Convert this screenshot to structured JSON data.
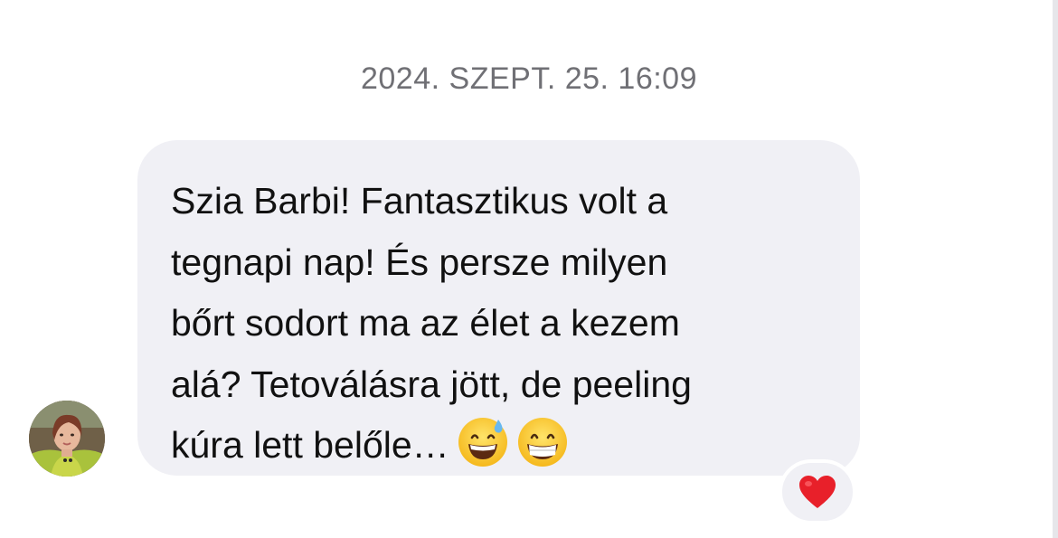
{
  "conversation": {
    "timestamp": "2024. SZEPT. 25. 16:09",
    "message": {
      "lines": [
        "Szia Barbi! Fantasztikus volt a",
        "tegnapi nap! És persze milyen",
        "bőrt sodort ma az élet a kezem",
        "alá? Tetoválásra jött, de peeling",
        "kúra lett belőle…"
      ],
      "trailing_emojis": [
        "grinning-face-with-sweat-icon",
        "beaming-face-icon"
      ],
      "reaction": "red-heart-icon"
    },
    "sender_avatar": "avatar"
  },
  "colors": {
    "bubble": "#f0f0f5",
    "timestamp_text": "#707075",
    "message_text": "#111111",
    "heart": "#e8202a"
  }
}
